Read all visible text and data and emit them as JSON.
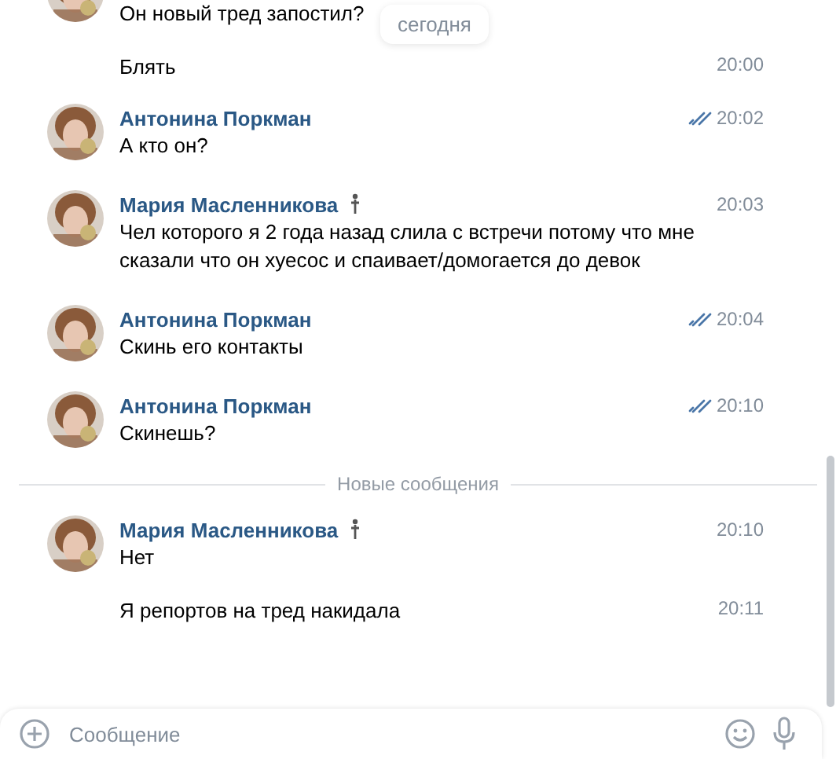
{
  "date_chip": "сегодня",
  "groups": [
    {
      "kind": "continued",
      "avatar": {
        "kind": "picture"
      },
      "messages": [
        {
          "text": "Он новый тред запостил?"
        },
        {
          "text": "Блять",
          "time": "20:00",
          "read": false
        }
      ]
    },
    {
      "kind": "full",
      "author": "Антонина Поркман",
      "avatar": {
        "kind": "picture"
      },
      "status_icon": false,
      "messages": [
        {
          "text": "А кто он?",
          "time": "20:02",
          "read": true
        }
      ]
    },
    {
      "kind": "full",
      "author": "Мария Масленникова",
      "avatar": {
        "kind": "picture"
      },
      "status_icon": true,
      "messages": [
        {
          "text": "Чел которого я 2 года назад слила с встречи потому что мне сказали что он хуесос и спаивает/домогается до девок",
          "time": "20:03",
          "read": false
        }
      ]
    },
    {
      "kind": "full",
      "author": "Антонина Поркман",
      "avatar": {
        "kind": "picture"
      },
      "status_icon": false,
      "messages": [
        {
          "text": "Скинь его контакты",
          "time": "20:04",
          "read": true
        }
      ]
    },
    {
      "kind": "full",
      "author": "Антонина Поркман",
      "avatar": {
        "kind": "picture"
      },
      "status_icon": false,
      "messages": [
        {
          "text": "Скинешь?",
          "time": "20:10",
          "read": true
        }
      ]
    },
    {
      "kind": "divider",
      "label": "Новые сообщения"
    },
    {
      "kind": "full",
      "author": "Мария Масленникова",
      "avatar": {
        "kind": "picture"
      },
      "status_icon": true,
      "messages": [
        {
          "text": "Нет",
          "time": "20:10",
          "read": false
        },
        {
          "text": "Я репортов на тред накидала",
          "time": "20:11",
          "read": false
        }
      ]
    }
  ],
  "composer": {
    "placeholder": "Сообщение"
  }
}
